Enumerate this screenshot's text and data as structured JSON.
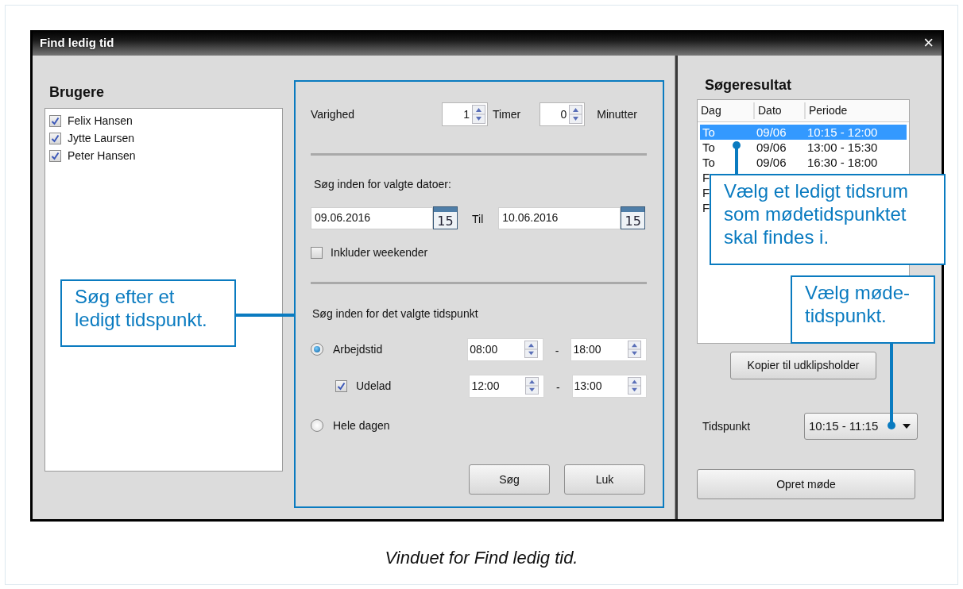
{
  "window": {
    "title": "Find ledig tid",
    "close": "×"
  },
  "users": {
    "title": "Brugere",
    "items": [
      {
        "name": "Felix Hansen",
        "checked": true
      },
      {
        "name": "Jytte Laursen",
        "checked": true
      },
      {
        "name": "Peter Hansen",
        "checked": true
      }
    ]
  },
  "search": {
    "duration": {
      "label": "Varighed",
      "hours": "1",
      "hours_unit": "Timer",
      "minutes": "0",
      "minutes_unit": "Minutter"
    },
    "dates": {
      "label": "Søg inden for valgte datoer:",
      "from": "09.06.2016",
      "from_calendar": "15",
      "to_label": "Til",
      "to": "10.06.2016",
      "to_calendar": "15"
    },
    "include_weekends": {
      "label": "Inkluder weekender",
      "checked": false
    },
    "time": {
      "label": "Søg inden for det valgte tidspunkt",
      "options": [
        {
          "label": "Arbejdstid",
          "selected": true,
          "from": "08:00",
          "separator": "-",
          "to": "18:00"
        },
        {
          "label": "Hele dagen",
          "selected": false
        }
      ],
      "exclude": {
        "label": "Udelad",
        "checked": true,
        "from": "12:00",
        "separator": "-",
        "to": "13:00"
      }
    },
    "buttons": [
      "Søg",
      "Luk"
    ]
  },
  "results": {
    "title": "Søgeresultat",
    "columns": [
      "Dag",
      "Dato",
      "Periode"
    ],
    "rows": [
      {
        "cells": [
          "To",
          "09/06",
          "10:15 - 12:00"
        ],
        "selected": true
      },
      {
        "cells": [
          "To",
          "09/06",
          "13:00 - 15:30"
        ],
        "selected": false
      },
      {
        "cells": [
          "To",
          "09/06",
          "16:30 - 18:00"
        ],
        "selected": false
      },
      {
        "cells": [
          "F"
        ],
        "selected": false
      },
      {
        "cells": [
          "F"
        ],
        "selected": false
      },
      {
        "cells": [
          "F"
        ],
        "selected": false
      }
    ],
    "copy_button": "Kopier til udklipsholder",
    "time": {
      "label": "Tidspunkt",
      "value": "10:15 - 11:15"
    },
    "create_button": "Opret møde"
  },
  "callouts": [
    {
      "text": "Søg efter et ledigt tidspunkt."
    },
    {
      "text": "Vælg et ledigt tidsrum som mødetidspunktet skal findes i."
    },
    {
      "text": "Vælg møde-tidspunkt."
    }
  ],
  "caption": "Vinduet for Find ledig tid."
}
